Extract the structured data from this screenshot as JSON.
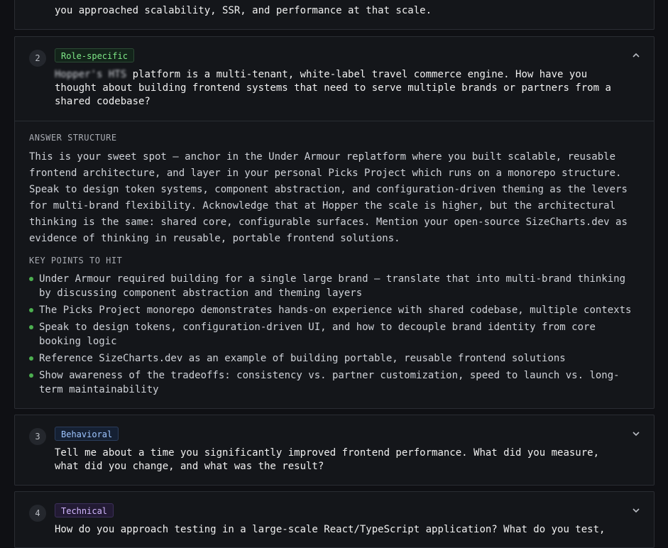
{
  "prev_question_tail": "you approached scalability, SSR, and performance at that scale.",
  "q2": {
    "number": "2",
    "badge": "Role-specific",
    "question_redacted": "Hopper's HTS",
    "question_rest": " platform is a multi-tenant, white-label travel commerce engine. How have you thought about building frontend systems that need to serve multiple brands or partners from a shared codebase?",
    "answer_label": "ANSWER STRUCTURE",
    "answer": "This is your sweet spot — anchor in the Under Armour replatform where you built scalable, reusable frontend architecture, and layer in your personal Picks Project which runs on a monorepo structure. Speak to design token systems, component abstraction, and configuration-driven theming as the levers for multi-brand flexibility. Acknowledge that at Hopper the scale is higher, but the architectural thinking is the same: shared core, configurable surfaces. Mention your open-source SizeCharts.dev as evidence of thinking in reusable, portable frontend solutions.",
    "points_label": "KEY POINTS TO HIT",
    "points": [
      "Under Armour required building for a single large brand — translate that into multi-brand thinking by discussing component abstraction and theming layers",
      "The Picks Project monorepo demonstrates hands-on experience with shared codebase, multiple contexts",
      "Speak to design tokens, configuration-driven UI, and how to decouple brand identity from core booking logic",
      "Reference SizeCharts.dev as an example of building portable, reusable frontend solutions",
      "Show awareness of the tradeoffs: consistency vs. partner customization, speed to launch vs. long-term maintainability"
    ]
  },
  "q3": {
    "number": "3",
    "badge": "Behavioral",
    "question": "Tell me about a time you significantly improved frontend performance. What did you measure, what did you change, and what was the result?"
  },
  "q4": {
    "number": "4",
    "badge": "Technical",
    "question": "How do you approach testing in a large-scale React/TypeScript application? What do you test,"
  },
  "colors": {
    "background": "#0f1014",
    "card": "#14161a",
    "border": "#2a2d33",
    "bullet": "#4caf50",
    "role_badge": "#7ee787",
    "behavioral_badge": "#9ec5ff",
    "technical_badge": "#d2b7ff"
  },
  "icons": {
    "collapse": "chevron-up-icon",
    "expand": "chevron-down-icon"
  }
}
